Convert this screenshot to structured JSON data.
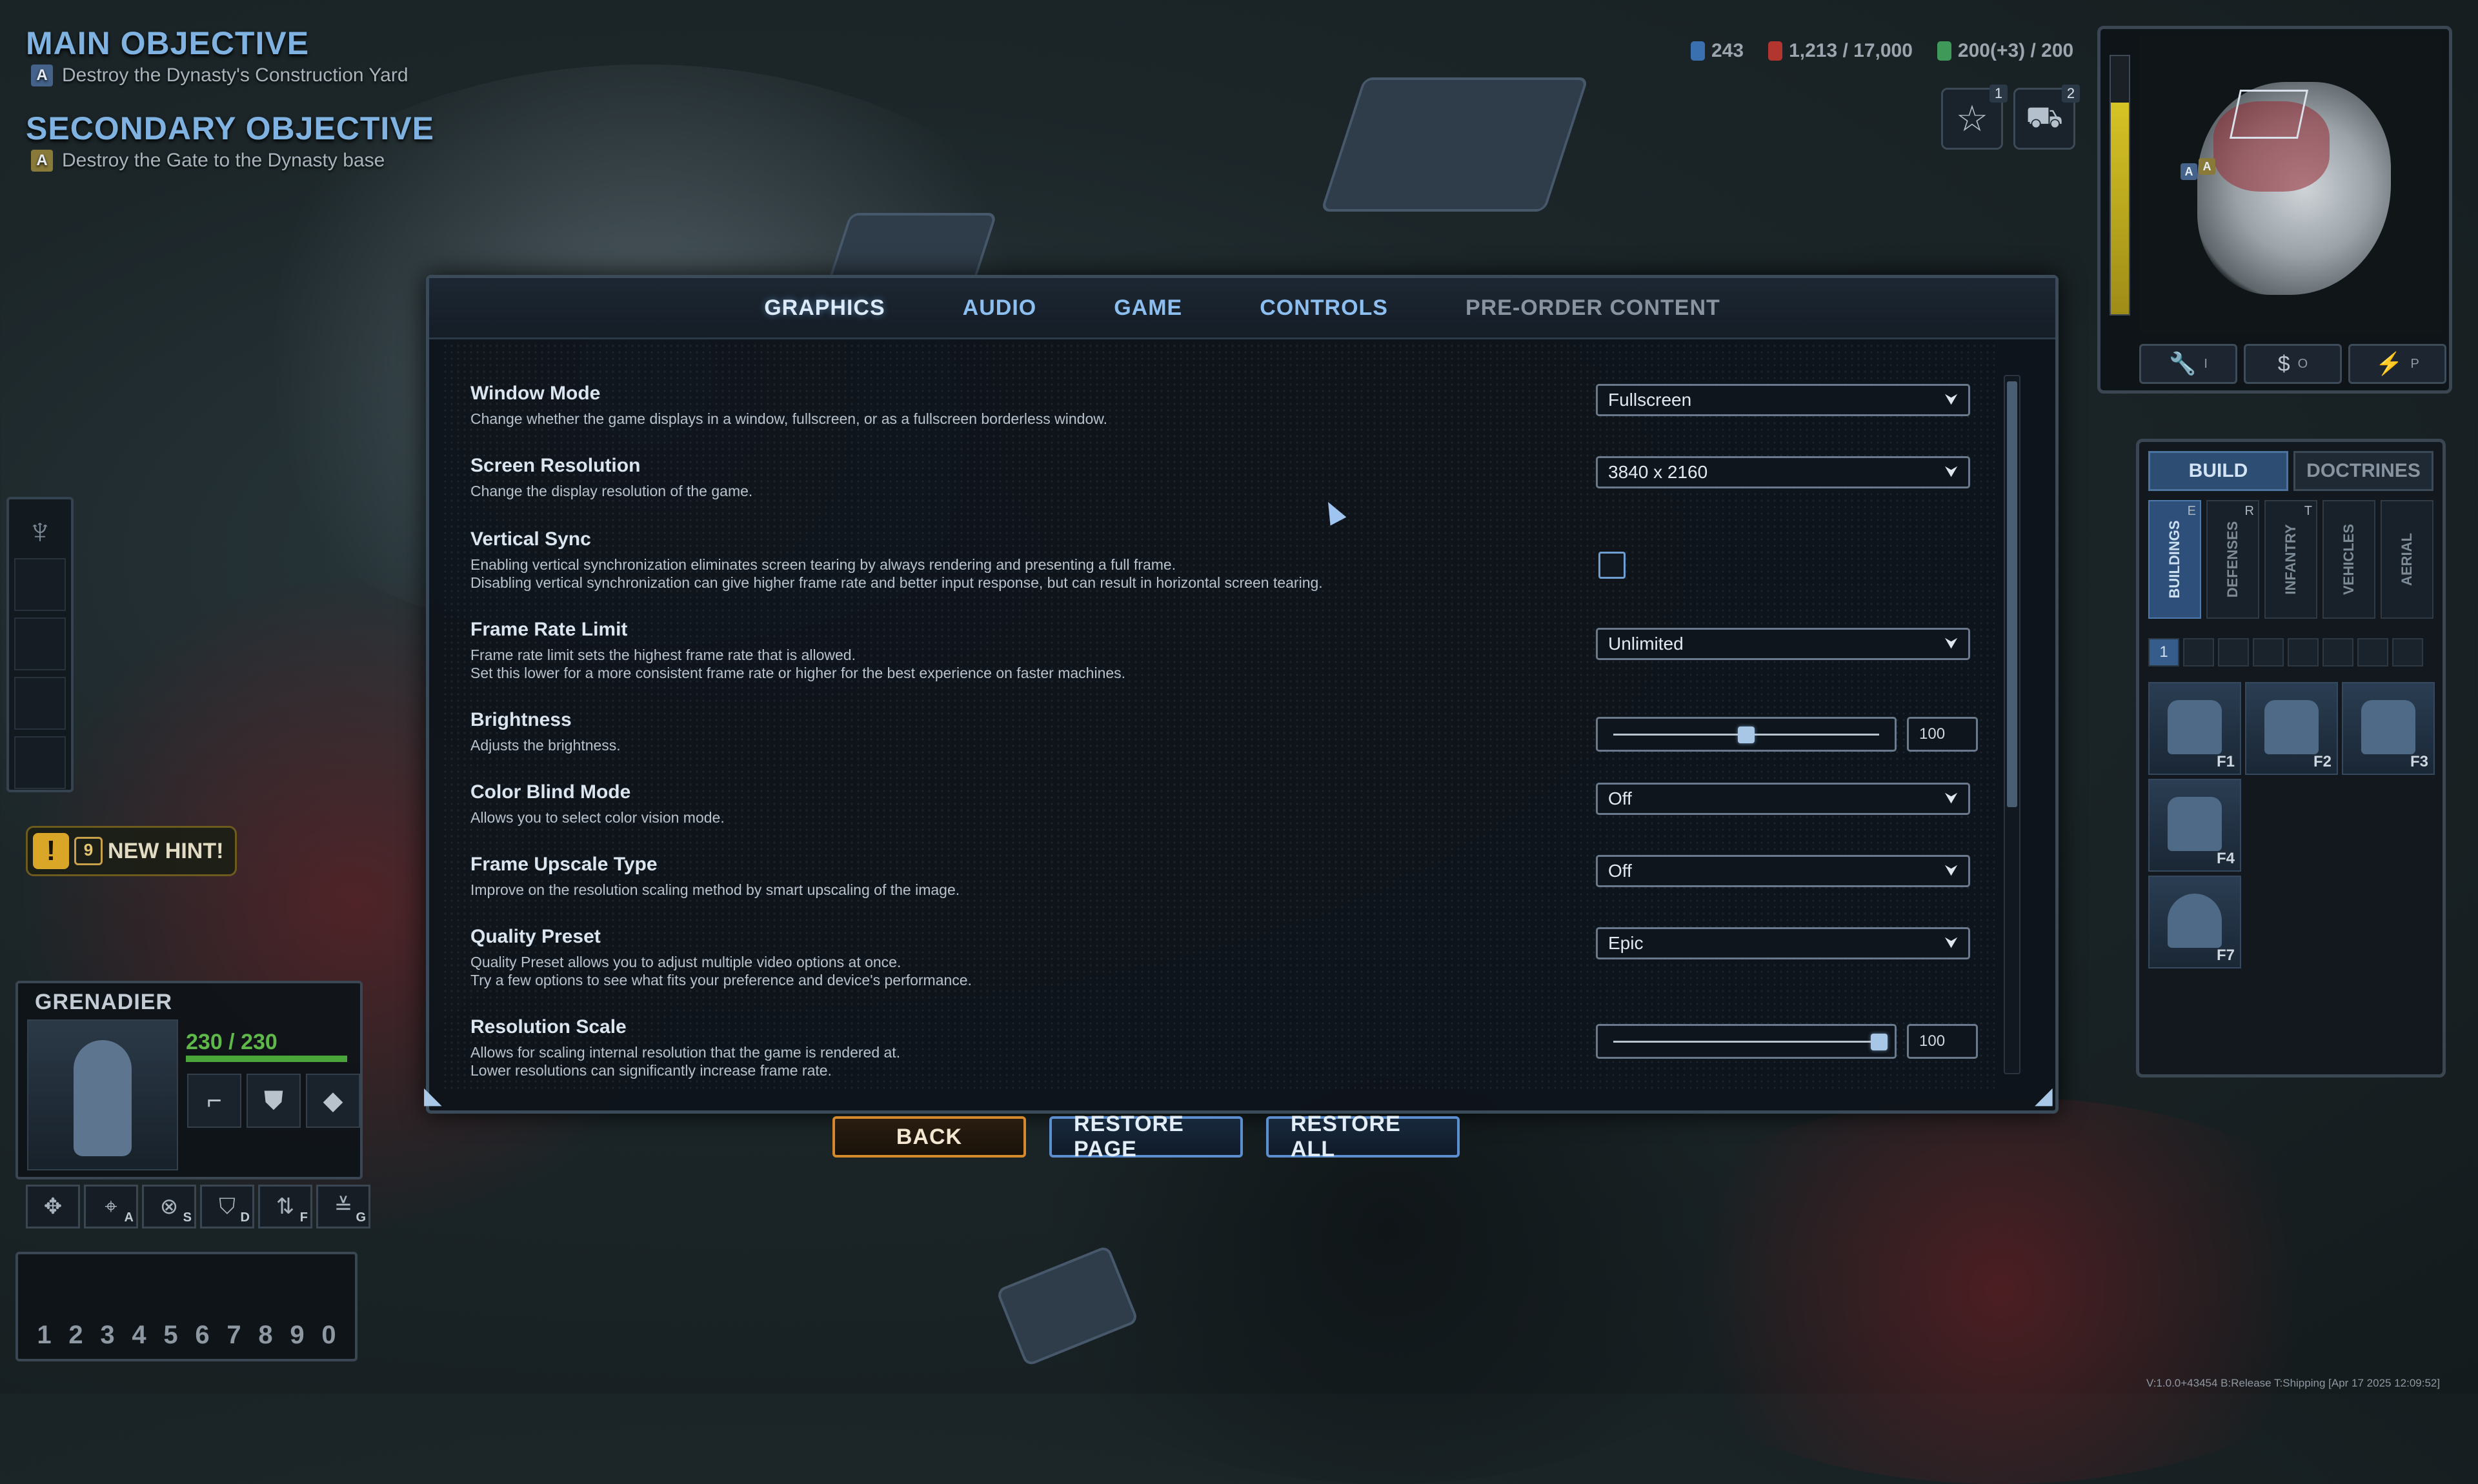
{
  "objectives": {
    "main_title": "MAIN OBJECTIVE",
    "main_badge": "A",
    "main_text": "Destroy the Dynasty's Construction Yard",
    "secondary_title": "SECONDARY OBJECTIVE",
    "secondary_badge": "A",
    "secondary_text": "Destroy the Gate to the Dynasty base"
  },
  "resources": {
    "power": "243",
    "credits": "1,213 / 17,000",
    "population": "200(+3) / 200",
    "colors": {
      "power": "#3a6fb0",
      "credits": "#b2352f",
      "population": "#3f9a5a"
    }
  },
  "rank": {
    "star_count": "1",
    "vehicle_count": "2"
  },
  "minimap": {
    "badge_a1": "A",
    "badge_a2": "A",
    "buttons": [
      {
        "icon": "wrench-icon",
        "glyph": "🔧",
        "key": "I"
      },
      {
        "icon": "dollar-icon",
        "glyph": "$",
        "key": "O"
      },
      {
        "icon": "power-icon",
        "glyph": "⚡",
        "key": "P"
      }
    ],
    "power_level": 0.82
  },
  "build_panel": {
    "tabs": [
      "BUILD",
      "DOCTRINES"
    ],
    "active_tab": "BUILD",
    "categories": [
      {
        "label": "BUILDINGS",
        "key": "E",
        "active": true
      },
      {
        "label": "DEFENSES",
        "key": "R",
        "active": false
      },
      {
        "label": "INFANTRY",
        "key": "T",
        "active": false
      },
      {
        "label": "VEHICLES",
        "key": "",
        "active": false
      },
      {
        "label": "AERIAL",
        "key": "",
        "active": false
      }
    ],
    "slot_active": "1",
    "units": [
      {
        "key": "F1"
      },
      {
        "key": "F2"
      },
      {
        "key": "F3"
      },
      {
        "key": "F4"
      },
      {
        "key": "F7"
      }
    ]
  },
  "hint": {
    "icon": "!",
    "count": "9",
    "text": "NEW HINT!"
  },
  "unit_card": {
    "name": "GRENADIER",
    "hp": "230 / 230",
    "abilities": [
      {
        "icon": "rifle-icon",
        "glyph": "⌐"
      },
      {
        "icon": "shield-icon",
        "glyph": "⛊"
      },
      {
        "icon": "grenade-icon",
        "glyph": "◆"
      }
    ]
  },
  "commands": [
    {
      "icon": "move-icon",
      "glyph": "✥",
      "key": ""
    },
    {
      "icon": "attack-move-icon",
      "glyph": "⌖",
      "key": "A"
    },
    {
      "icon": "stop-icon",
      "glyph": "⊗",
      "key": "S"
    },
    {
      "icon": "guard-icon",
      "glyph": "⛉",
      "key": "D"
    },
    {
      "icon": "formation-icon",
      "glyph": "⇅",
      "key": "F"
    },
    {
      "icon": "rank-icon",
      "glyph": "≚",
      "key": "G"
    }
  ],
  "control_groups": [
    "1",
    "2",
    "3",
    "4",
    "5",
    "6",
    "7",
    "8",
    "9",
    "0"
  ],
  "tabs": [
    {
      "label": "GRAPHICS",
      "state": "active"
    },
    {
      "label": "AUDIO",
      "state": "normal"
    },
    {
      "label": "GAME",
      "state": "normal"
    },
    {
      "label": "CONTROLS",
      "state": "normal"
    },
    {
      "label": "PRE-ORDER CONTENT",
      "state": "dim"
    }
  ],
  "settings": {
    "window_mode": {
      "title": "Window Mode",
      "desc1": "Change whether the game displays in a window, fullscreen, or as a fullscreen borderless window.",
      "value": "Fullscreen"
    },
    "screen_resolution": {
      "title": "Screen Resolution",
      "desc1": "Change the display resolution of the game.",
      "value": "3840 x 2160"
    },
    "vertical_sync": {
      "title": "Vertical Sync",
      "desc1": "Enabling vertical synchronization eliminates screen tearing by always rendering and presenting a full frame.",
      "desc2": "Disabling vertical synchronization can give higher frame rate and better input response, but can result in horizontal screen tearing.",
      "checked": false
    },
    "frame_rate_limit": {
      "title": "Frame Rate Limit",
      "desc1": "Frame rate limit sets the highest frame rate that is allowed.",
      "desc2": "Set this lower for a more consistent frame rate or higher for the best experience on faster machines.",
      "value": "Unlimited"
    },
    "brightness": {
      "title": "Brightness",
      "desc1": "Adjusts the brightness.",
      "value": "100",
      "position": 0.5
    },
    "color_blind_mode": {
      "title": "Color Blind Mode",
      "desc1": "Allows you to select color vision mode.",
      "value": "Off"
    },
    "frame_upscale_type": {
      "title": "Frame Upscale Type",
      "desc1": "Improve on the resolution scaling method by smart upscaling of the image.",
      "value": "Off"
    },
    "quality_preset": {
      "title": "Quality Preset",
      "desc1": "Quality Preset allows you to adjust multiple video options at once.",
      "desc2": "Try a few options to see what fits your preference and device's performance.",
      "value": "Epic"
    },
    "resolution_scale": {
      "title": "Resolution Scale",
      "desc1": "Allows for scaling internal resolution that the game is rendered at.",
      "desc2": "Lower resolutions can significantly increase frame rate.",
      "value": "100",
      "position": 1.0
    }
  },
  "footer": {
    "back": "BACK",
    "restore_page": "RESTORE PAGE",
    "restore_all": "RESTORE ALL"
  },
  "build_info": "V:1.0.0+43454 B:Release T:Shipping [Apr 17 2025 12:09:52]"
}
